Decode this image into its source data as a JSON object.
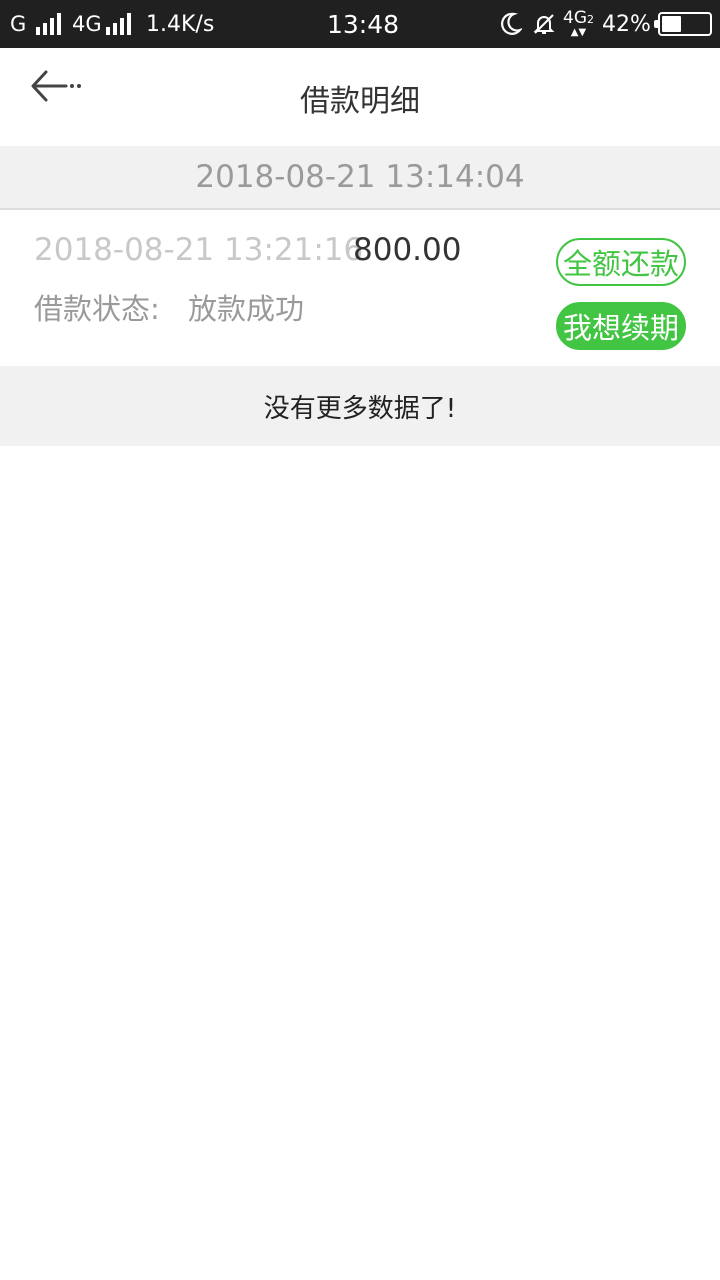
{
  "status_bar": {
    "carrier1": "G",
    "carrier2": "4G",
    "speed": "1.4K/s",
    "time": "13:48",
    "network2": "4G",
    "network2_sub": "2",
    "battery_pct": "42%",
    "battery_level": 0.42
  },
  "header": {
    "title": "借款明细",
    "back_icon": "arrow-left-icon"
  },
  "date_header": "2018-08-21 13:14:04",
  "record": {
    "time": "2018-08-21 13:21:16",
    "amount": "800.00",
    "status_label": "借款状态:",
    "status_value": "放款成功",
    "repay_label": "全额还款",
    "renew_label": "我想续期"
  },
  "footer_message": "没有更多数据了!",
  "colors": {
    "accent_green": "#42c542",
    "status_bar_bg": "#202020",
    "section_bg": "#f1f1f1"
  }
}
